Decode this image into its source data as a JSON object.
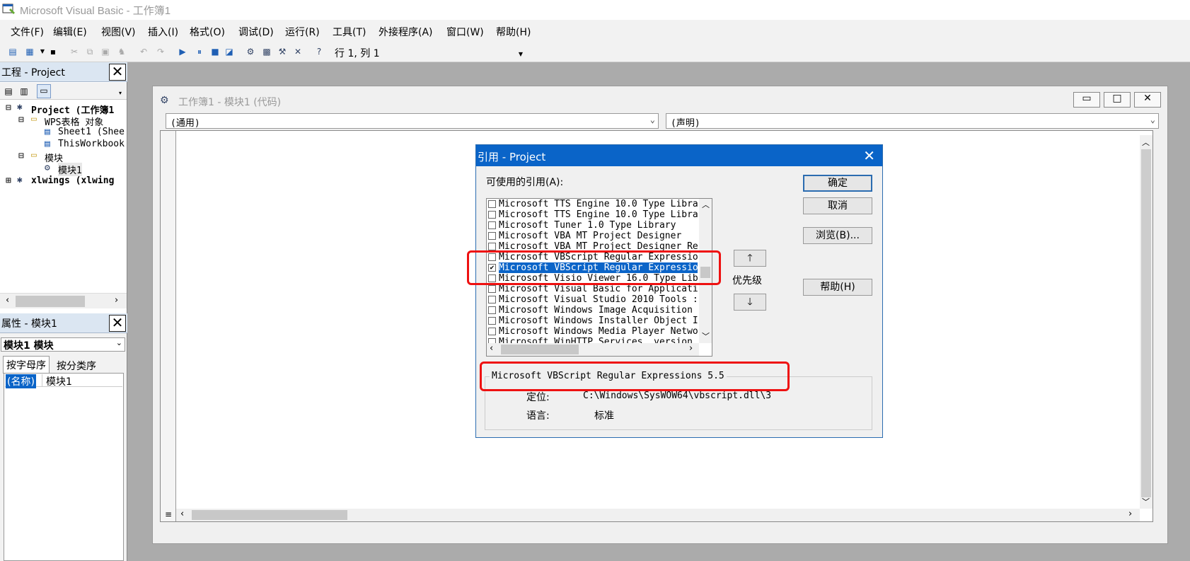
{
  "app": {
    "title": "Microsoft Visual Basic - 工作簿1"
  },
  "menu": [
    "文件(F)",
    "编辑(E)",
    "视图(V)",
    "插入(I)",
    "格式(O)",
    "调试(D)",
    "运行(R)",
    "工具(T)",
    "外接程序(A)",
    "窗口(W)",
    "帮助(H)"
  ],
  "toolbar": {
    "cursor_position": "行 1, 列 1"
  },
  "project_panel": {
    "title": "工程 - Project",
    "tree": [
      "Project (工作簿1",
      "WPS表格 对象",
      "Sheet1 (Shee",
      "ThisWorkbook",
      "模块",
      "模块1",
      "xlwings (xlwing"
    ]
  },
  "properties_panel": {
    "title": "属性 - 模块1",
    "object_select": "模块1 模块",
    "tabs": [
      "按字母序",
      "按分类序"
    ],
    "rows": [
      {
        "name": "(名称)",
        "value": "模块1"
      }
    ]
  },
  "code_window": {
    "title": "工作簿1 - 模块1 (代码)",
    "object_combo": "(通用)",
    "proc_combo": "(声明)"
  },
  "references_dialog": {
    "title": "引用 - Project",
    "available_label": "可使用的引用(A):",
    "items": [
      {
        "label": "Microsoft TTS Engine 10.0 Type Libra",
        "checked": false
      },
      {
        "label": "Microsoft TTS Engine 10.0 Type Libra",
        "checked": false
      },
      {
        "label": "Microsoft Tuner 1.0 Type Library",
        "checked": false
      },
      {
        "label": "Microsoft VBA MT Project Designer",
        "checked": false
      },
      {
        "label": "Microsoft VBA MT Project Designer Re",
        "checked": false
      },
      {
        "label": "Microsoft VBScript Regular Expressio",
        "checked": false
      },
      {
        "label": "Microsoft VBScript Regular Expressio",
        "checked": true,
        "selected": true
      },
      {
        "label": "Microsoft Visio Viewer 16.0 Type Lib",
        "checked": false
      },
      {
        "label": "Microsoft Visual Basic for Applicati",
        "checked": false
      },
      {
        "label": "Microsoft Visual Studio 2010 Tools :",
        "checked": false
      },
      {
        "label": "Microsoft Windows Image Acquisition",
        "checked": false
      },
      {
        "label": "Microsoft Windows Installer Object I",
        "checked": false
      },
      {
        "label": "Microsoft Windows Media Player Netwo",
        "checked": false
      },
      {
        "label": "Microsoft WinHTTP Services, version",
        "checked": false
      }
    ],
    "buttons": {
      "ok": "确定",
      "cancel": "取消",
      "browse": "浏览(B)...",
      "help": "帮助(H)"
    },
    "priority_label": "优先级",
    "info": {
      "name": "Microsoft VBScript Regular Expressions 5.5",
      "location_label": "定位:",
      "location_value": "C:\\Windows\\SysWOW64\\vbscript.dll\\3",
      "language_label": "语言:",
      "language_value": "标准"
    }
  },
  "colors": {
    "accent": "#0a64c8",
    "highlight": "#e11111",
    "mdi_bg": "#ababab"
  }
}
